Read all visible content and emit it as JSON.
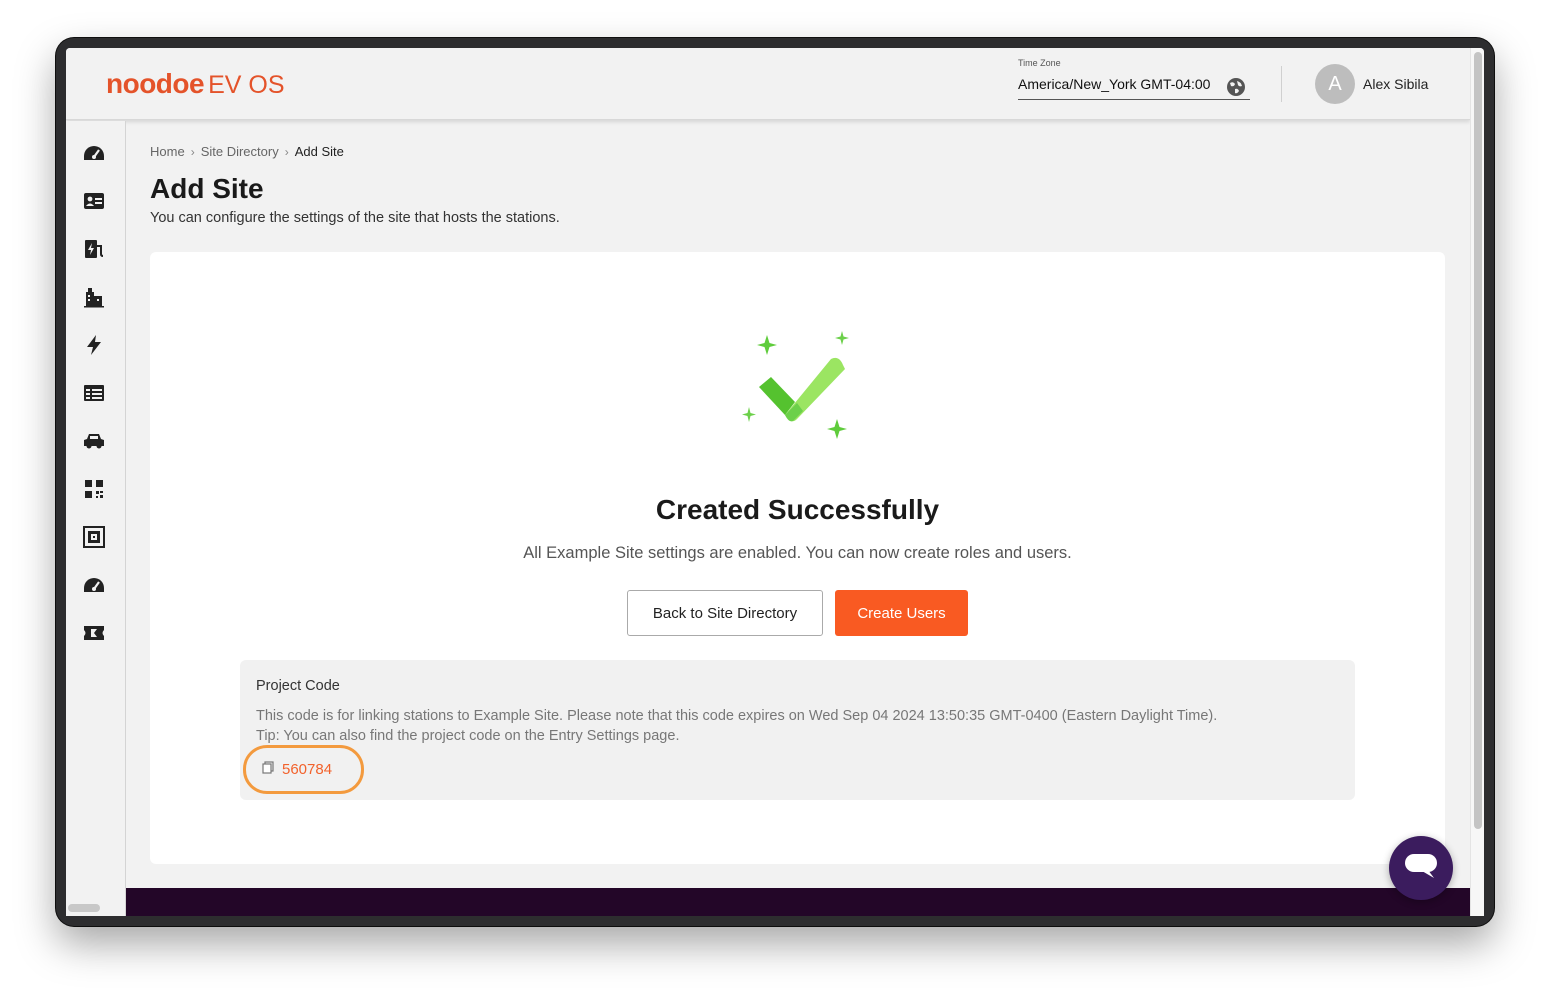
{
  "brand": {
    "name": "noodoe",
    "suffix": "EV OS",
    "color": "#e4532a"
  },
  "header": {
    "timezone_label": "Time Zone",
    "timezone_value": "America/New_York GMT-04:00",
    "user": {
      "initial": "A",
      "name": "Alex Sibila"
    }
  },
  "sidebar": {
    "items": [
      {
        "icon": "dashboard-gauge-icon"
      },
      {
        "icon": "id-card-icon"
      },
      {
        "icon": "charging-station-icon"
      },
      {
        "icon": "buildings-icon"
      },
      {
        "icon": "lightning-bolt-icon"
      },
      {
        "icon": "table-list-icon"
      },
      {
        "icon": "car-icon"
      },
      {
        "icon": "qr-code-icon"
      },
      {
        "icon": "framed-device-icon"
      },
      {
        "icon": "gauge-icon"
      },
      {
        "icon": "ticket-icon"
      }
    ]
  },
  "breadcrumb": {
    "home": "Home",
    "directory": "Site Directory",
    "current": "Add Site"
  },
  "page": {
    "title": "Add Site",
    "subtitle": "You can configure the settings of the site that hosts the stations."
  },
  "success": {
    "title": "Created Successfully",
    "message": "All Example Site settings are enabled. You can now create roles and users.",
    "back_label": "Back to Site Directory",
    "create_label": "Create Users"
  },
  "project_code": {
    "title": "Project Code",
    "description_line1": "This code is for linking stations to Example Site. Please note that this code expires on Wed Sep 04 2024 13:50:35 GMT-0400 (Eastern Daylight Time).",
    "description_line2": "Tip: You can also find the project code on the Entry Settings page.",
    "code": "560784"
  },
  "colors": {
    "accent": "#f95a22",
    "highlight_ring": "#f39a3e",
    "success_green": "#6cd04a",
    "footer": "#230628",
    "chat": "#3b1c5e"
  }
}
